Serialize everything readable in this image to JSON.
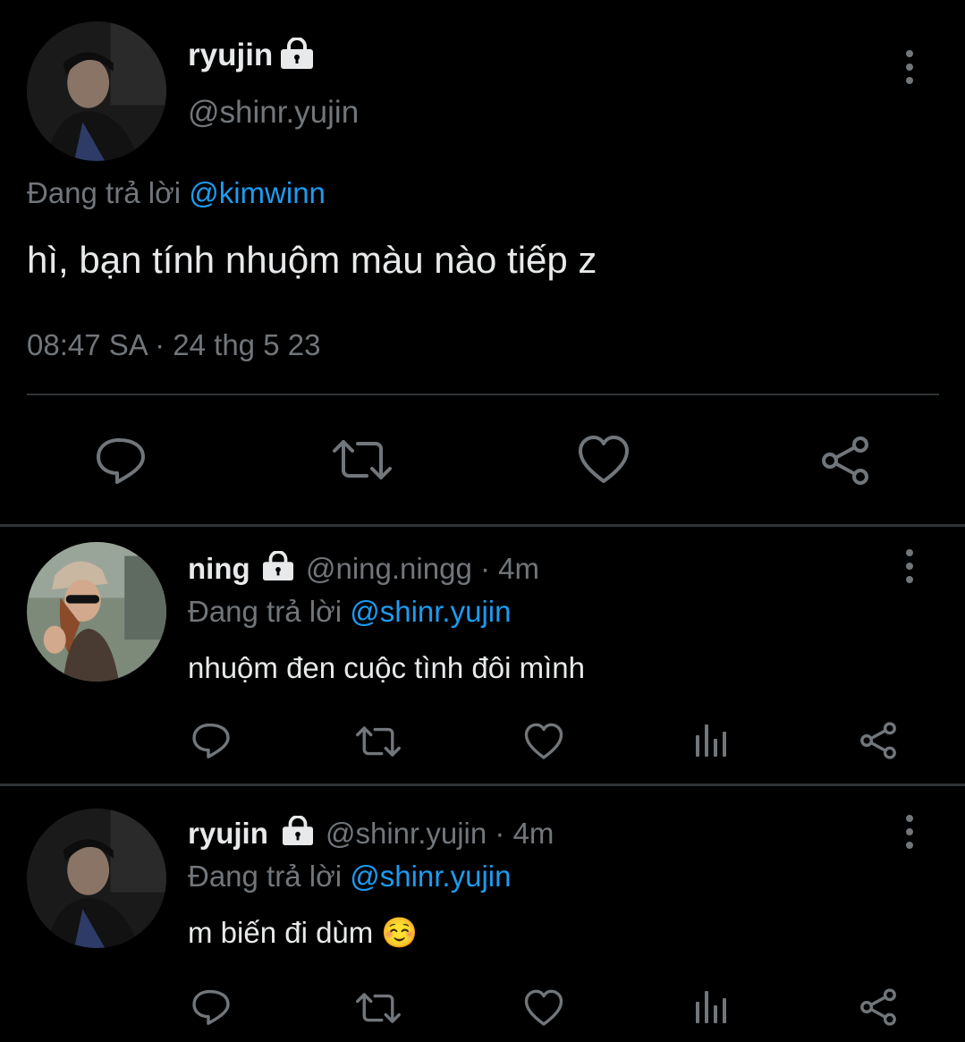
{
  "main_tweet": {
    "display_name": "ryujin",
    "handle": "@shinr.yujin",
    "replying_prefix": "Đang trả lời",
    "replying_to": "@kimwinn",
    "text": "hì, bạn tính nhuộm màu nào tiếp z",
    "timestamp": "08:47 SA · 24 thg 5 23"
  },
  "replies": [
    {
      "display_name": "ning",
      "meta": "@ning.ningg · 4m",
      "replying_prefix": "Đang trả lời",
      "replying_to": "@shinr.yujin",
      "text": "nhuộm đen cuộc tình đôi mình"
    },
    {
      "display_name": "ryujin",
      "meta": "@shinr.yujin · 4m",
      "replying_prefix": "Đang trả lời",
      "replying_to": "@shinr.yujin",
      "text": "m biến đi dùm ☺️"
    }
  ],
  "icons": {
    "lock": "lock-icon",
    "more": "more-vertical-icon",
    "reply": "reply-icon",
    "retweet": "retweet-icon",
    "like": "heart-icon",
    "views": "analytics-icon",
    "share": "share-icon"
  },
  "colors": {
    "background": "#000000",
    "text": "#e7e9ea",
    "muted": "#71767b",
    "link": "#1d9bf0",
    "divider": "#2f3336"
  }
}
